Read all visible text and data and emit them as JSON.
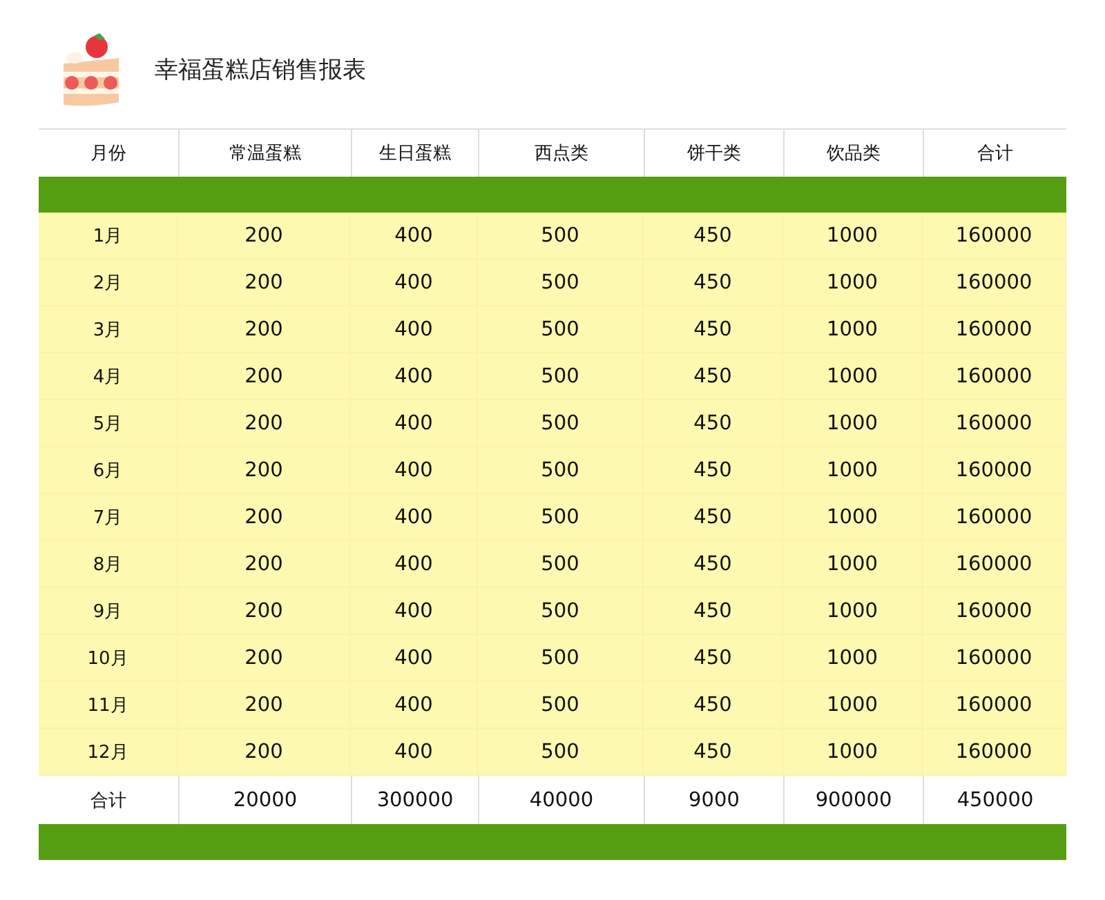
{
  "title": "幸福蛋糕店销售报表",
  "table": {
    "columns": [
      "月份",
      "常温蛋糕",
      "生日蛋糕",
      "西点类",
      "饼干类",
      "饮品类",
      "合计"
    ],
    "rows": [
      [
        "1月",
        "200",
        "400",
        "500",
        "450",
        "1000",
        "160000"
      ],
      [
        "2月",
        "200",
        "400",
        "500",
        "450",
        "1000",
        "160000"
      ],
      [
        "3月",
        "200",
        "400",
        "500",
        "450",
        "1000",
        "160000"
      ],
      [
        "4月",
        "200",
        "400",
        "500",
        "450",
        "1000",
        "160000"
      ],
      [
        "5月",
        "200",
        "400",
        "500",
        "450",
        "1000",
        "160000"
      ],
      [
        "6月",
        "200",
        "400",
        "500",
        "450",
        "1000",
        "160000"
      ],
      [
        "7月",
        "200",
        "400",
        "500",
        "450",
        "1000",
        "160000"
      ],
      [
        "8月",
        "200",
        "400",
        "500",
        "450",
        "1000",
        "160000"
      ],
      [
        "9月",
        "200",
        "400",
        "500",
        "450",
        "1000",
        "160000"
      ],
      [
        "10月",
        "200",
        "400",
        "500",
        "450",
        "1000",
        "160000"
      ],
      [
        "11月",
        "200",
        "400",
        "500",
        "450",
        "1000",
        "160000"
      ],
      [
        "12月",
        "200",
        "400",
        "500",
        "450",
        "1000",
        "160000"
      ]
    ],
    "total_row": [
      "合计",
      "20000",
      "300000",
      "40000",
      "9000",
      "900000",
      "450000"
    ]
  }
}
